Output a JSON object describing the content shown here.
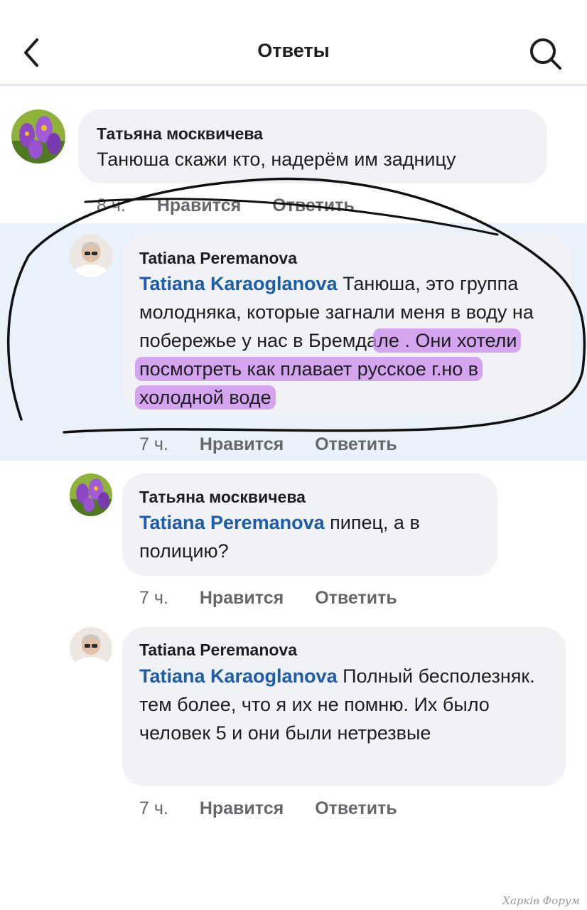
{
  "header": {
    "title": "Ответы"
  },
  "comments": [
    {
      "author": "Татьяна москвичева",
      "text": "Танюша скажи кто, надерём им задницу",
      "time": "8 ч.",
      "like_label": "Нравится",
      "reply_label": "Ответить"
    },
    {
      "author": "Tatiana Peremanova",
      "mention": "Tatiana Karaoglanova",
      "text_plain": " Танюша, это группа молодняка, которые загнали меня в воду на побережье у нас в Бремда",
      "text_highlight": "ле . Они хотели посмотреть как плавает русское г.но в холодной воде",
      "time": "7 ч.",
      "like_label": "Нравится",
      "reply_label": "Ответить"
    },
    {
      "author": "Татьяна москвичева",
      "mention": "Tatiana Peremanova",
      "text": " пипец, а в полицию?",
      "time": "7 ч.",
      "like_label": "Нравится",
      "reply_label": "Ответить"
    },
    {
      "author": "Tatiana Peremanova",
      "mention": "Tatiana Karaoglanova",
      "text": " Полный бесполезняк. тем более, что я их не помню. Их было человек 5 и они были нетрезвые",
      "time": "7 ч.",
      "like_label": "Нравится",
      "reply_label": "Ответить"
    }
  ],
  "watermark": "Харків Форум",
  "colors": {
    "mention": "#1d5ca8",
    "highlight_row": "#e9f1fb",
    "marker": "#cb89ec",
    "bubble": "#f0f2f5"
  },
  "icons": {
    "back": "chevron-left-icon",
    "search": "search-icon"
  }
}
